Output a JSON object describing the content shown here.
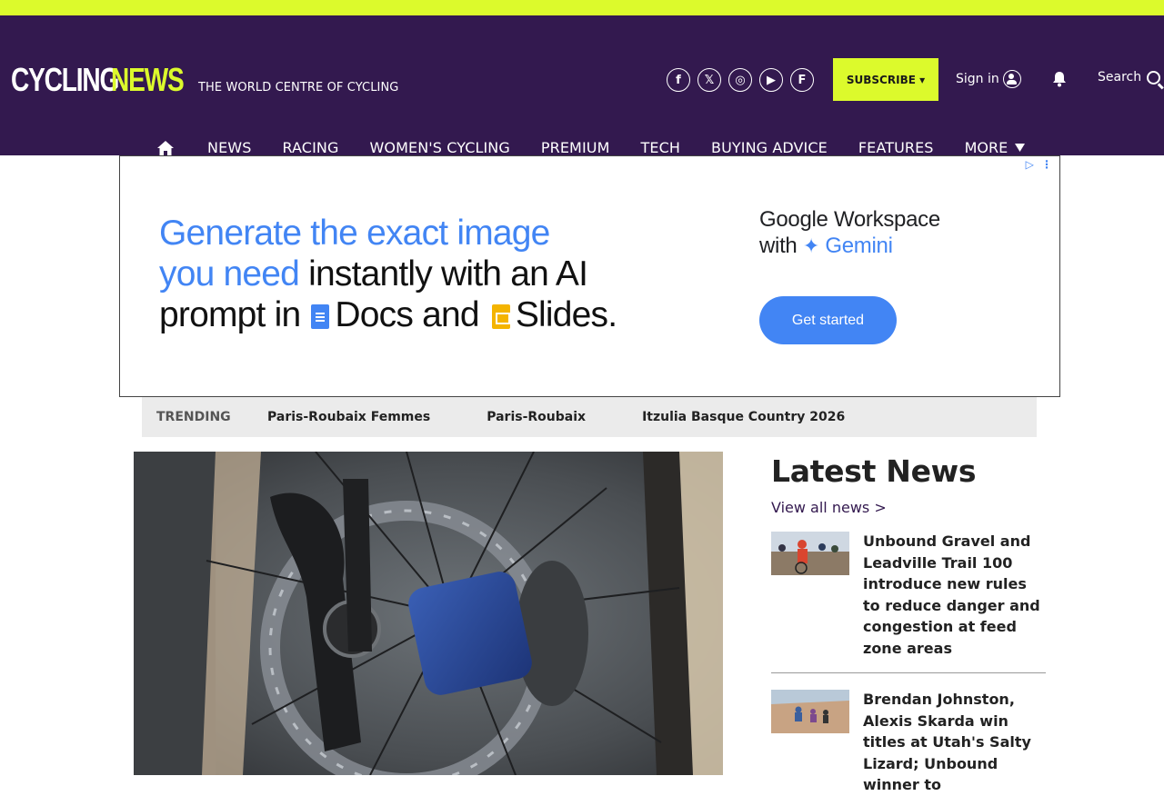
{
  "header": {
    "logo_part1": "CYCLING",
    "logo_part2": "NEWS",
    "tagline": "THE WORLD CENTRE OF CYCLING",
    "socials": [
      {
        "icon": "facebook-icon",
        "glyph": "f"
      },
      {
        "icon": "x-icon",
        "glyph": "𝕏"
      },
      {
        "icon": "instagram-icon",
        "glyph": "◎"
      },
      {
        "icon": "youtube-icon",
        "glyph": "▶"
      },
      {
        "icon": "flipboard-icon",
        "glyph": "F"
      }
    ],
    "subscribe_label": "SUBSCRIBE ▾",
    "signin_label": "Sign in",
    "search_label": "Search"
  },
  "nav": {
    "items": [
      "NEWS",
      "RACING",
      "WOMEN'S CYCLING",
      "PREMIUM",
      "TECH",
      "BUYING ADVICE",
      "FEATURES"
    ],
    "more_label": "MORE"
  },
  "ad": {
    "line1": "Generate the exact image",
    "line2_blue": "you need",
    "line2_rest": " instantly with an AI",
    "line3_a": "prompt in ",
    "line3_docs": "Docs and ",
    "line3_slides": "Slides.",
    "brand_line1": "Google Workspace",
    "brand_with": "with ",
    "brand_gemini": "Gemini",
    "cta": "Get started"
  },
  "trending": {
    "label": "TRENDING",
    "items": [
      "Paris-Roubaix Femmes",
      "Paris-Roubaix",
      "Itzulia Basque Country 2026"
    ]
  },
  "latest": {
    "title": "Latest News",
    "view_all": "View all news >",
    "items": [
      {
        "title": "Unbound Gravel and Leadville Trail 100 introduce new rules to reduce danger and congestion at feed zone areas"
      },
      {
        "title": "Brendan Johnston, Alexis Skarda win titles at Utah's Salty Lizard; Unbound winner to"
      }
    ]
  },
  "colors": {
    "brand_purple": "#33194f",
    "accent_lime": "#dcfa2c",
    "google_blue": "#4285f4"
  }
}
